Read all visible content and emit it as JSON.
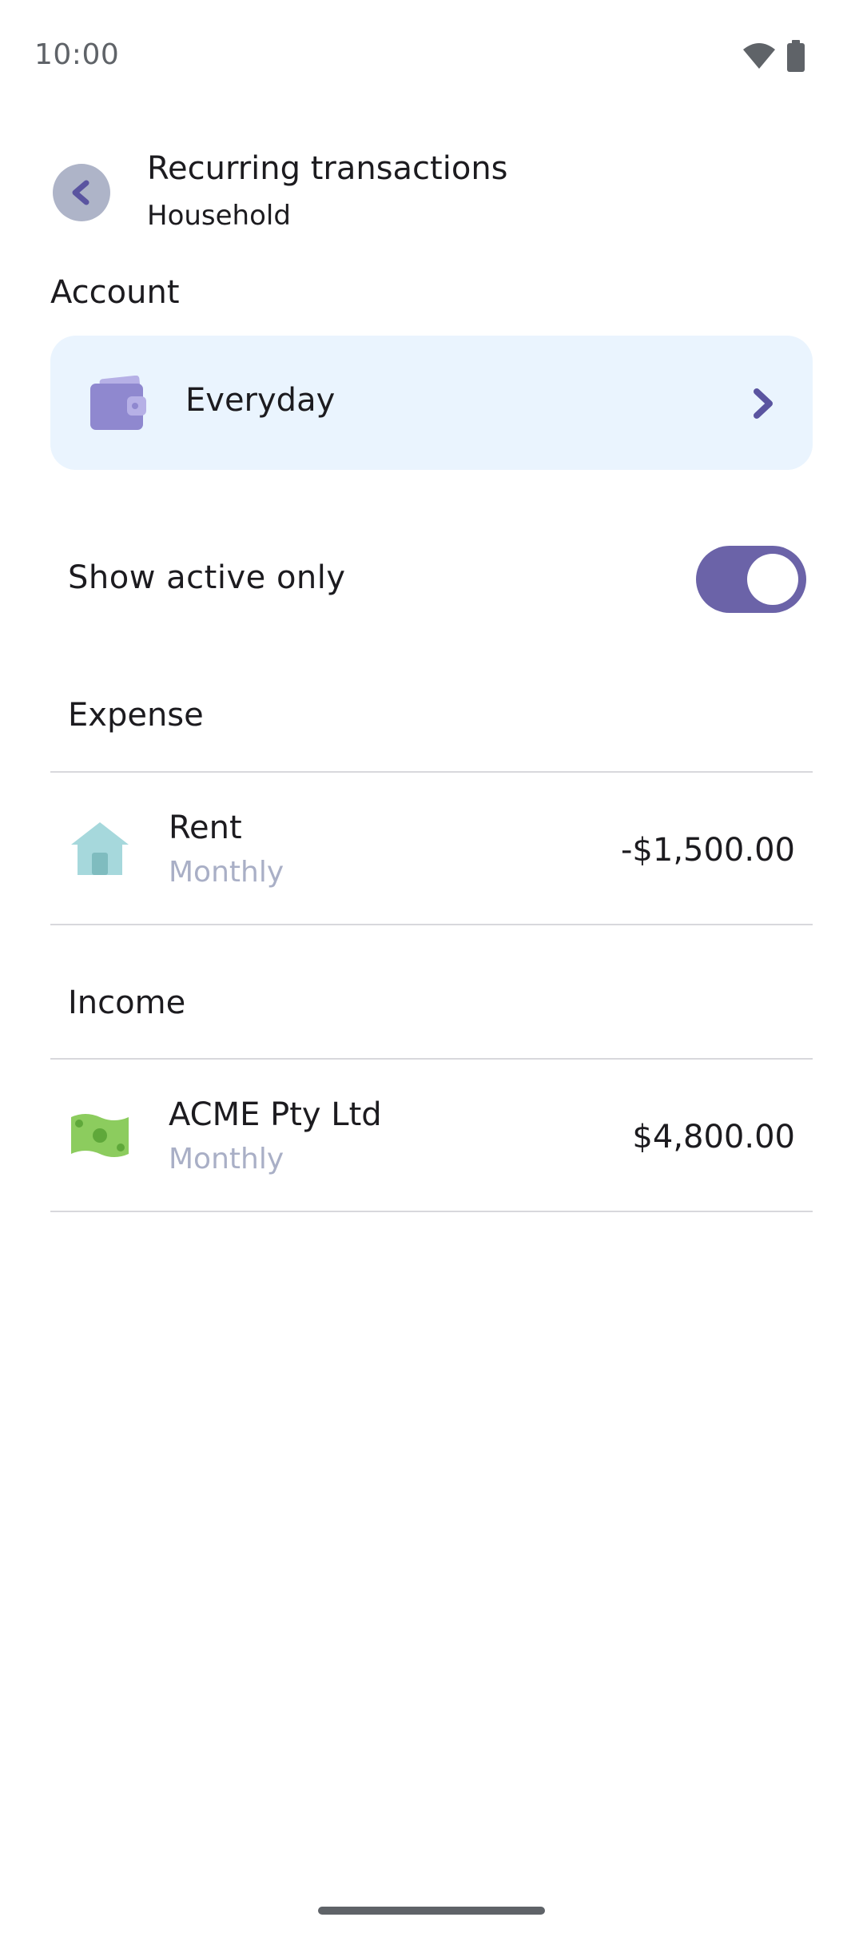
{
  "status_bar": {
    "time": "10:00",
    "wifi_icon": "wifi-icon",
    "battery_icon": "battery-icon"
  },
  "header": {
    "back_icon": "chevron-left-icon",
    "title": "Recurring transactions",
    "subtitle": "Household"
  },
  "account": {
    "label": "Account",
    "icon": "wallet-icon",
    "name": "Everyday",
    "chevron_icon": "chevron-right-icon"
  },
  "filter": {
    "label": "Show active only",
    "enabled": true
  },
  "sections": {
    "expense": {
      "title": "Expense",
      "items": [
        {
          "icon": "house-icon",
          "name": "Rent",
          "frequency": "Monthly",
          "amount": "-$1,500.00"
        }
      ]
    },
    "income": {
      "title": "Income",
      "items": [
        {
          "icon": "cash-icon",
          "name": "ACME Pty Ltd",
          "frequency": "Monthly",
          "amount": "$4,800.00"
        }
      ]
    }
  },
  "colors": {
    "accent": "#6b63a8",
    "card_background": "#eaf4fe",
    "secondary_text": "#a9afc6"
  }
}
